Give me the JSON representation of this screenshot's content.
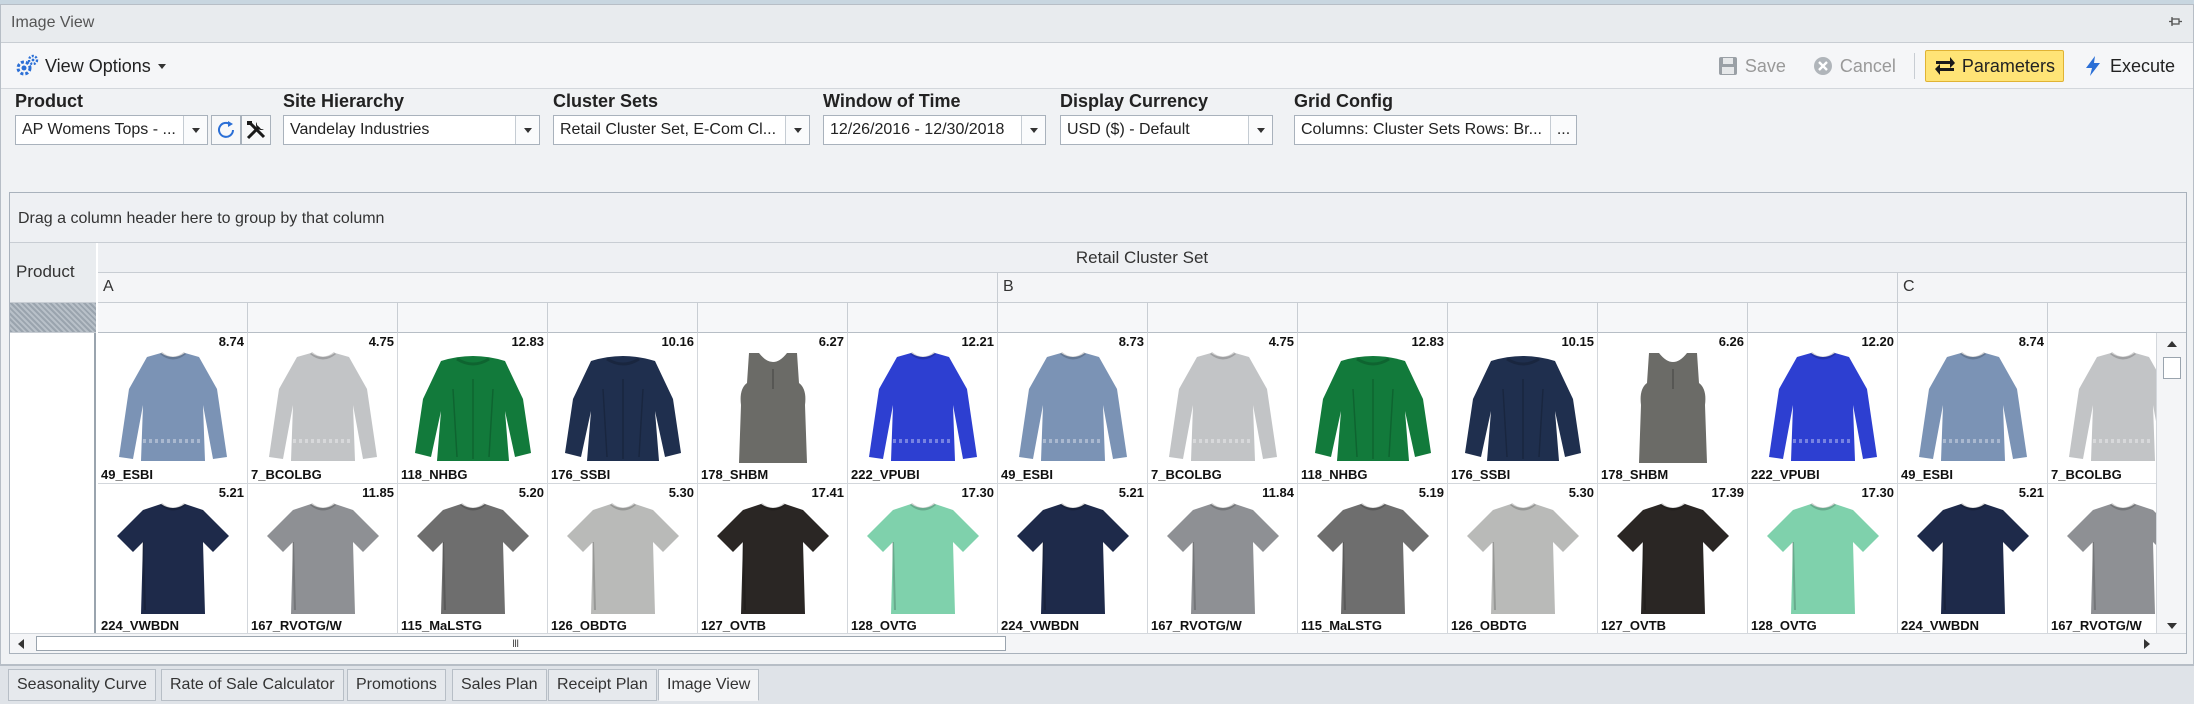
{
  "window": {
    "title": "Image View"
  },
  "toolbar": {
    "view_options_label": "View Options",
    "save_label": "Save",
    "cancel_label": "Cancel",
    "parameters_label": "Parameters",
    "execute_label": "Execute"
  },
  "params": {
    "product": {
      "label": "Product",
      "value": "AP Womens Tops - ..."
    },
    "site_hierarchy": {
      "label": "Site Hierarchy",
      "value": "Vandelay Industries"
    },
    "cluster_sets": {
      "label": "Cluster Sets",
      "value": "Retail Cluster Set, E-Com Cl..."
    },
    "window_of_time": {
      "label": "Window of Time",
      "value": "12/26/2016 - 12/30/2018"
    },
    "display_currency": {
      "label": "Display Currency",
      "value": "USD ($) - Default"
    },
    "grid_config": {
      "label": "Grid Config",
      "value": "Columns: Cluster Sets Rows: Br...",
      "ellipsis": "..."
    }
  },
  "grid": {
    "group_panel_text": "Drag a column header here to group by that column",
    "row_header_label": "Product",
    "band_label": "Retail Cluster Set",
    "clusters": [
      "A",
      "B",
      "C"
    ],
    "rows": [
      [
        {
          "value": "8.74",
          "code": "49_ESBI",
          "garment": "longsleeve",
          "color": "#7b93b5"
        },
        {
          "value": "4.75",
          "code": "7_BCOLBG",
          "garment": "longsleeve",
          "color": "#c2c4c6"
        },
        {
          "value": "12.83",
          "code": "118_NHBG",
          "garment": "blouse",
          "color": "#127a3b"
        },
        {
          "value": "10.16",
          "code": "176_SSBI",
          "garment": "blouse",
          "color": "#1f2f4e"
        },
        {
          "value": "6.27",
          "code": "178_SHBM",
          "garment": "tank",
          "color": "#6b6b67"
        },
        {
          "value": "12.21",
          "code": "222_VPUBI",
          "garment": "longsleeve",
          "color": "#2d3fd1"
        },
        {
          "value": "8.73",
          "code": "49_ESBI",
          "garment": "longsleeve",
          "color": "#7b93b5"
        },
        {
          "value": "4.75",
          "code": "7_BCOLBG",
          "garment": "longsleeve",
          "color": "#c2c4c6"
        },
        {
          "value": "12.83",
          "code": "118_NHBG",
          "garment": "blouse",
          "color": "#127a3b"
        },
        {
          "value": "10.15",
          "code": "176_SSBI",
          "garment": "blouse",
          "color": "#1f2f4e"
        },
        {
          "value": "6.26",
          "code": "178_SHBM",
          "garment": "tank",
          "color": "#6b6b67"
        },
        {
          "value": "12.20",
          "code": "222_VPUBI",
          "garment": "longsleeve",
          "color": "#2d3fd1"
        },
        {
          "value": "8.74",
          "code": "49_ESBI",
          "garment": "longsleeve",
          "color": "#7b93b5"
        },
        {
          "value": "",
          "code": "7_BCOLBG",
          "garment": "longsleeve",
          "color": "#c2c4c6"
        }
      ],
      [
        {
          "value": "5.21",
          "code": "224_VWBDN",
          "garment": "tee",
          "color": "#1e2a4a"
        },
        {
          "value": "11.85",
          "code": "167_RVOTG/W",
          "garment": "tee",
          "color": "#8e9094"
        },
        {
          "value": "5.20",
          "code": "115_MaLSTG",
          "garment": "tee",
          "color": "#6e6e6e"
        },
        {
          "value": "5.30",
          "code": "126_OBDTG",
          "garment": "tee",
          "color": "#b9bab8"
        },
        {
          "value": "17.41",
          "code": "127_OVTB",
          "garment": "tee",
          "color": "#2a2624"
        },
        {
          "value": "17.30",
          "code": "128_OVTG",
          "garment": "tee",
          "color": "#7fd1ac"
        },
        {
          "value": "5.21",
          "code": "224_VWBDN",
          "garment": "tee",
          "color": "#1e2a4a"
        },
        {
          "value": "11.84",
          "code": "167_RVOTG/W",
          "garment": "tee",
          "color": "#8e9094"
        },
        {
          "value": "5.19",
          "code": "115_MaLSTG",
          "garment": "tee",
          "color": "#6e6e6e"
        },
        {
          "value": "5.30",
          "code": "126_OBDTG",
          "garment": "tee",
          "color": "#b9bab8"
        },
        {
          "value": "17.39",
          "code": "127_OVTB",
          "garment": "tee",
          "color": "#2a2624"
        },
        {
          "value": "17.30",
          "code": "128_OVTG",
          "garment": "tee",
          "color": "#7fd1ac"
        },
        {
          "value": "5.21",
          "code": "224_VWBDN",
          "garment": "tee",
          "color": "#1e2a4a"
        },
        {
          "value": "",
          "code": "167_RVOTG/W",
          "garment": "tee",
          "color": "#8e9094"
        }
      ]
    ],
    "scroll_grip": "III"
  },
  "tabs": [
    {
      "label": "Seasonality Curve",
      "active": false
    },
    {
      "label": "Rate of Sale Calculator",
      "active": false
    },
    {
      "label": "Promotions",
      "active": false
    },
    {
      "label": "Sales Plan",
      "active": false
    },
    {
      "label": "Receipt Plan",
      "active": false
    },
    {
      "label": "Image View",
      "active": true
    }
  ],
  "colors": {
    "parameters_bg": "#ffe476",
    "accent_blue": "#2b6fd6"
  }
}
